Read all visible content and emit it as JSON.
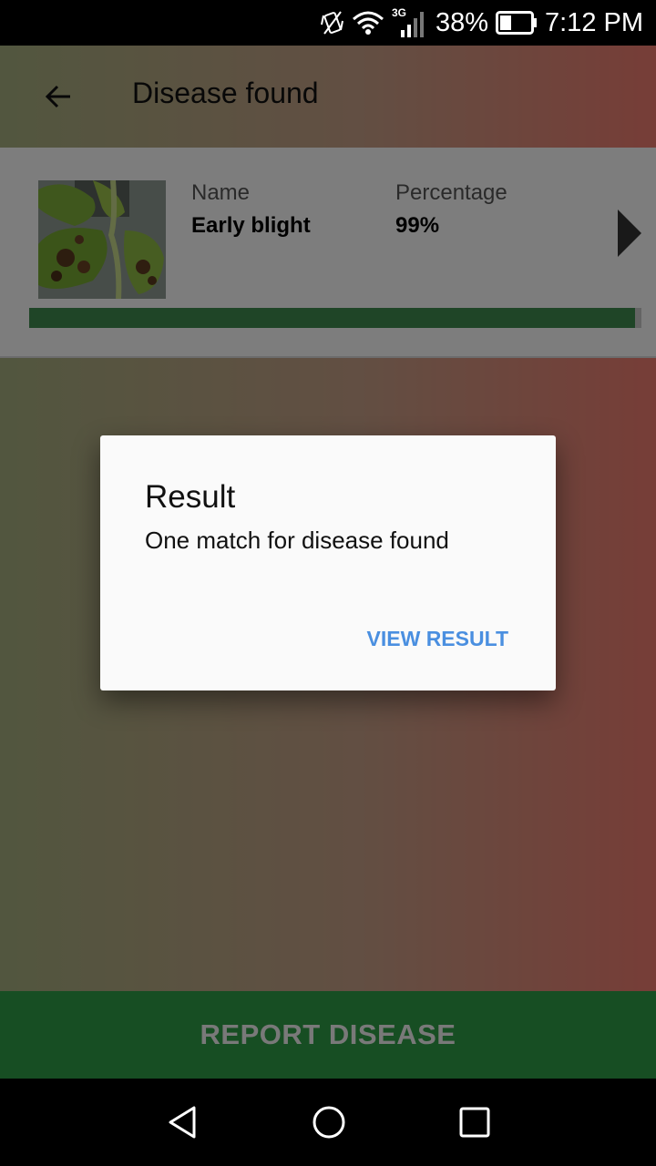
{
  "status_bar": {
    "network": "3G",
    "battery": "38%",
    "time": "7:12 PM",
    "icons": [
      "vibrate-icon",
      "wifi-icon",
      "cellular-signal-icon",
      "battery-icon"
    ],
    "battery_level": 0.38
  },
  "toolbar": {
    "back_icon": "arrow-back-icon",
    "title": "Disease found"
  },
  "result_card": {
    "name_label": "Name",
    "name_value": "Early blight",
    "percentage_label": "Percentage",
    "percentage_value": "99%",
    "progress_fraction": 0.99,
    "next_icon": "play-arrow-icon"
  },
  "dialog": {
    "title": "Result",
    "message": "One match for disease found",
    "action_label": "VIEW RESULT"
  },
  "report_button": {
    "label": "REPORT DISEASE"
  },
  "nav_bar": {
    "icons": [
      "back-triangle-icon",
      "home-circle-icon",
      "recents-square-icon"
    ]
  },
  "colors": {
    "accent_green": "#2f9c46",
    "progress_green": "#3f8b4f",
    "dialog_action_blue": "#4a8fe0"
  }
}
